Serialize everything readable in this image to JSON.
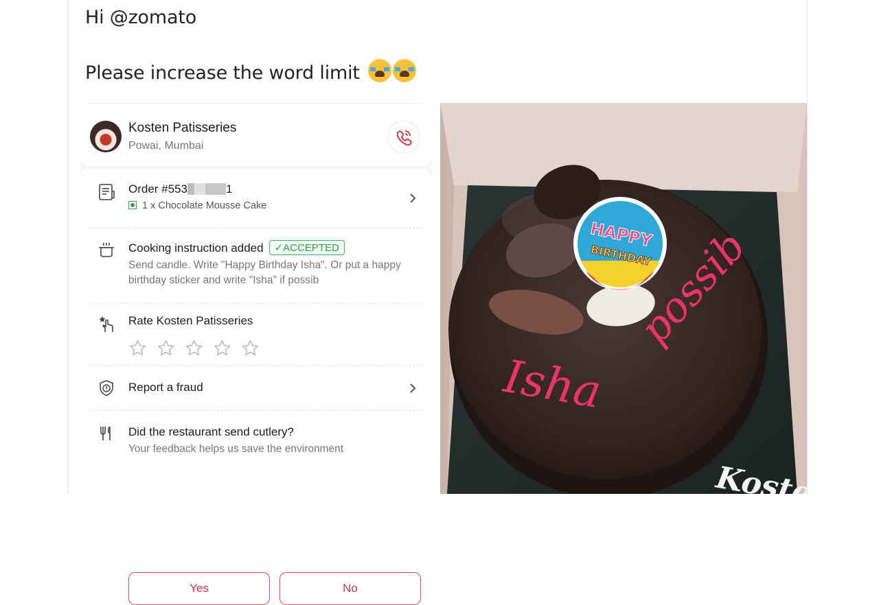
{
  "tweet": {
    "line1": "Hi @zomato",
    "line2": "Please increase the word limit"
  },
  "restaurant": {
    "name": "Kosten Patisseries",
    "location": "Powai, Mumbai"
  },
  "order": {
    "label_prefix": "Order #553",
    "label_suffix": "1",
    "item": "1 x Chocolate Mousse Cake"
  },
  "cooking": {
    "title": "Cooking instruction added",
    "badge": "ACCEPTED",
    "text": "Send candle. Write \"Happy Birthday Isha\". Or put a happy birthday sticker and write \"Isha\" if possib"
  },
  "rate": {
    "title": "Rate Kosten Patisseries",
    "rating": 0,
    "max": 5
  },
  "fraud": {
    "title": "Report a fraud"
  },
  "cutlery": {
    "title": "Did the restaurant send cutlery?",
    "sub": "Your feedback helps us save the environment",
    "yes": "Yes",
    "no": "No"
  },
  "photo": {
    "topper_line1": "HAPPY",
    "topper_line2": "BIRTHDAY",
    "piping_1": "Isha",
    "piping_2": "possib",
    "brand": "Kosten"
  },
  "colors": {
    "accent": "#d8334a",
    "veg_green": "#2e9e4f",
    "cake": "#3a2a26",
    "piping": "#e8336b"
  }
}
